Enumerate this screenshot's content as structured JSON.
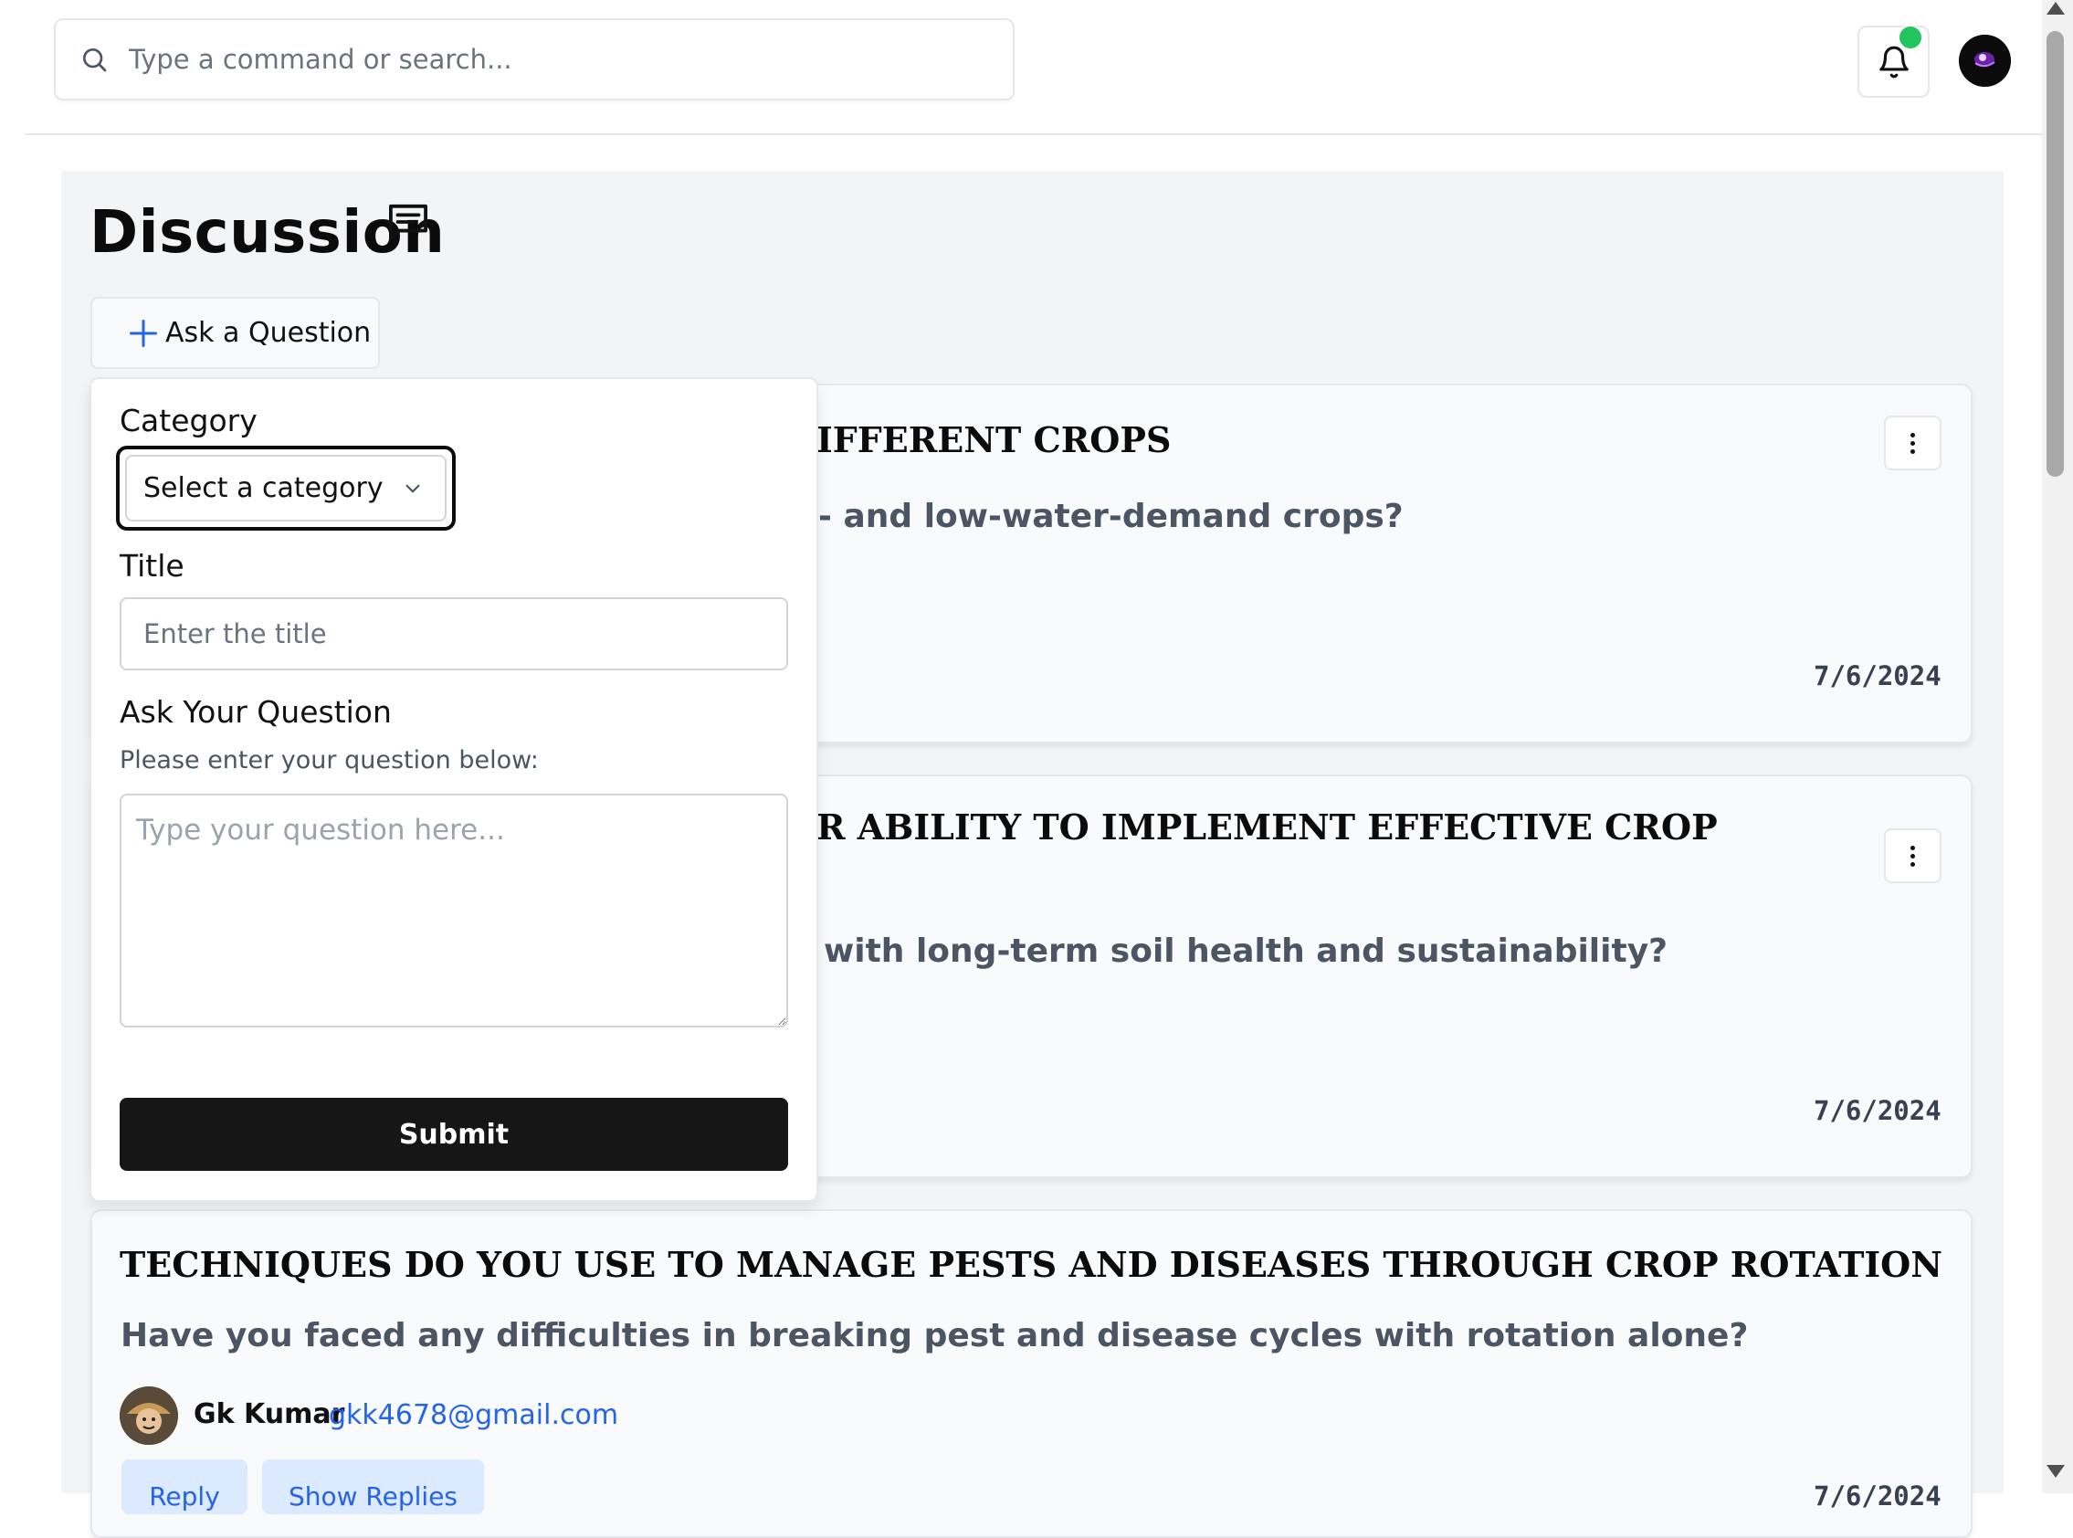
{
  "header": {
    "search_placeholder": "Type a command or search...",
    "icons": {
      "search": "search-icon",
      "bell": "bell-icon",
      "avatar": "user-avatar"
    },
    "notification_dot_color": "#22c55e"
  },
  "page": {
    "title": "Discussion",
    "title_icon": "message-square-icon",
    "ask_button_label": "Ask a Question"
  },
  "form": {
    "category_label": "Category",
    "category_placeholder": "Select a category",
    "title_label": "Title",
    "title_placeholder": "Enter the title",
    "question_label": "Ask Your Question",
    "question_hint": "Please enter your question below:",
    "question_placeholder": "Type your question here...",
    "submit_label": "Submit"
  },
  "cards": [
    {
      "title_visible": "IFFERENT CROPS",
      "question_visible": "- and low-water-demand crops?",
      "date": "7/6/2024"
    },
    {
      "title_visible": "R ABILITY TO IMPLEMENT EFFECTIVE CROP",
      "question_visible": "with long-term soil health and sustainability?",
      "date": "7/6/2024"
    },
    {
      "title": "TECHNIQUES DO YOU USE TO MANAGE PESTS AND DISEASES THROUGH CROP ROTATION",
      "question": "Have you faced any difficulties in breaking pest and disease cycles with rotation alone?",
      "author_name": "Gk Kumar",
      "author_email": "gkk4678@gmail.com",
      "reply_label": "Reply",
      "show_replies_label": "Show Replies",
      "date": "7/6/2024"
    }
  ]
}
